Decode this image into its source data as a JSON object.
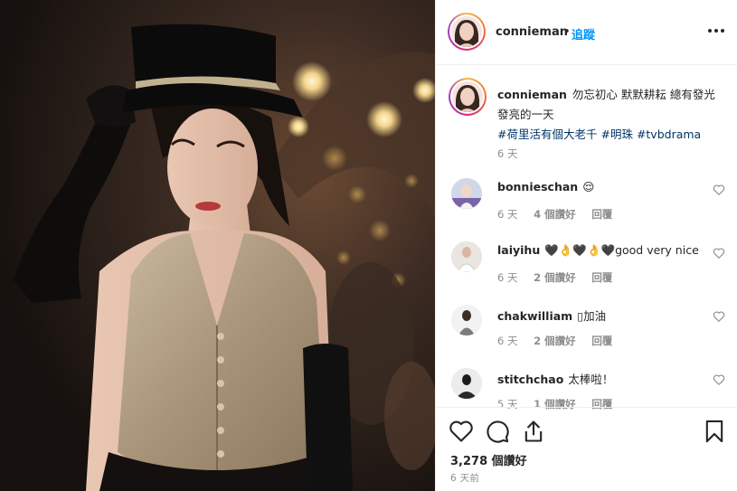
{
  "header": {
    "username": "connieman",
    "separator": "•",
    "follow_label": "追蹤",
    "more_icon": "more-options-icon"
  },
  "caption": {
    "username": "connieman",
    "text": "勿忘初心 默默耕耘 總有發光發亮的一天",
    "hashtags": [
      "#荷里活有個大老千",
      "#明珠",
      "#tvbdrama"
    ],
    "time": "6 天"
  },
  "comments": [
    {
      "username": "bonnieschan",
      "text": "😌",
      "time": "6 天",
      "likes": "4 個讚好",
      "reply": "回覆"
    },
    {
      "username": "laiyihu",
      "text": "🖤👌🖤👌🖤good very nice",
      "time": "6 天",
      "likes": "2 個讚好",
      "reply": "回覆"
    },
    {
      "username": "chakwilliam",
      "text": "▯加油",
      "time": "6 天",
      "likes": "2 個讚好",
      "reply": "回覆"
    },
    {
      "username": "stitchchao",
      "text": "太棒啦！",
      "time": "5 天",
      "likes": "1 個讚好",
      "reply": "回覆"
    }
  ],
  "footer": {
    "likes_count": "3,278 個讚好",
    "post_time": "6 天前",
    "icons": [
      "heart-outline-icon",
      "comment-bubble-icon",
      "share-upload-icon",
      "bookmark-icon"
    ]
  },
  "colors": {
    "link_blue": "#0095f6",
    "hashtag": "#003569",
    "muted": "#8e8e8e",
    "text": "#262626",
    "border": "#efefef"
  }
}
